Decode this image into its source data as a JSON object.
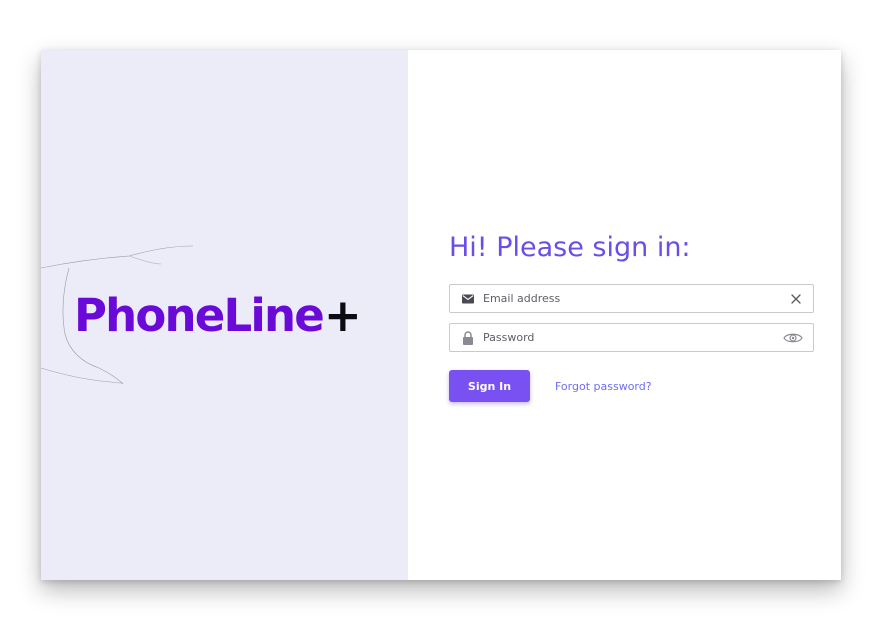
{
  "brand": {
    "name": "PhoneLine",
    "plus": "+",
    "color": "#6a0ad8",
    "plus_color": "#0b0b12"
  },
  "signin_form": {
    "title": "Hi! Please sign in:",
    "email": {
      "placeholder": "Email address",
      "value": "",
      "lead_icon": "mail-icon",
      "trail_icon": "clear-icon"
    },
    "password": {
      "placeholder": "Password",
      "value": "",
      "lead_icon": "lock-icon",
      "trail_icon": "eye-icon"
    },
    "submit_label": "Sign In",
    "forgot_label": "Forgot password?"
  },
  "colors": {
    "accent": "#7950f2",
    "title": "#6c4de6",
    "link": "#6f6ef0",
    "left_panel_bg": "#ecebf8"
  }
}
